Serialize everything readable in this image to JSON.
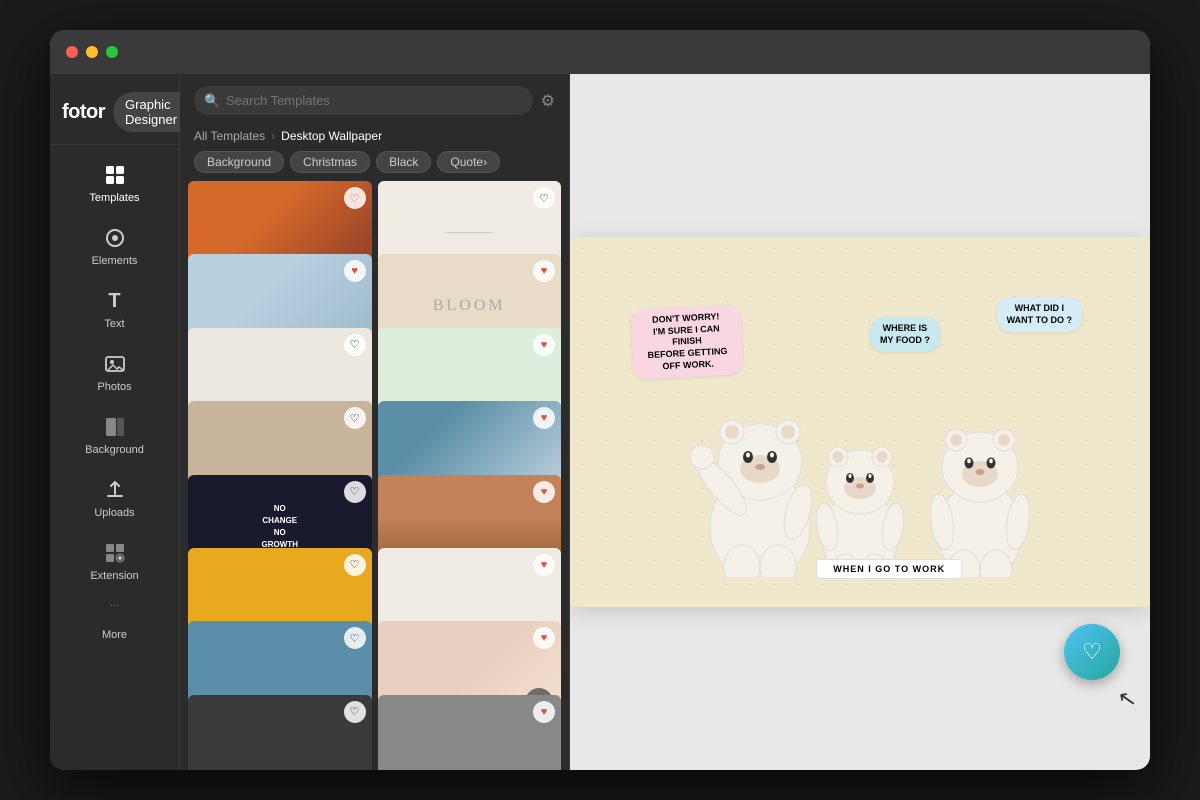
{
  "window": {
    "title": "Fotor Graphic Designer"
  },
  "header": {
    "logo": "fotor",
    "logo_sup": "®",
    "designer_label": "Graphic Designer",
    "chevron": "▾"
  },
  "sidebar": {
    "items": [
      {
        "id": "templates",
        "label": "Templates",
        "icon": "⊞",
        "active": true
      },
      {
        "id": "elements",
        "label": "Elements",
        "icon": "◎"
      },
      {
        "id": "text",
        "label": "Text",
        "icon": "T"
      },
      {
        "id": "photos",
        "label": "Photos",
        "icon": "🖼"
      },
      {
        "id": "background",
        "label": "Background",
        "icon": "◧"
      },
      {
        "id": "uploads",
        "label": "Uploads",
        "icon": "⬆"
      },
      {
        "id": "extension",
        "label": "Extension",
        "icon": "▦"
      },
      {
        "id": "more",
        "label": "More",
        "icon": "···"
      }
    ]
  },
  "templates_panel": {
    "search_placeholder": "Search Templates",
    "filter_icon": "▼",
    "breadcrumb": {
      "root": "All Templates",
      "sep": "›",
      "current": "Desktop Wallpaper"
    },
    "filter_tags": [
      "Background",
      "Christmas",
      "Black",
      "Quote"
    ],
    "scroll_up_icon": "▲"
  },
  "canvas": {
    "speech_bubbles": [
      {
        "text": "DON'T WORRY!\nI'M SURE I CAN FINISH\nBEFORE GETTING OFF WORK.",
        "style": "pink",
        "class": "bear-left-bubble"
      },
      {
        "text": "WHERE IS\nMY FOOD ?",
        "style": "blue",
        "class": "bear-mid-bubble"
      },
      {
        "text": "WHAT DID I\nWANT TO DO ?",
        "style": "light-blue",
        "class": "bear-right-bubble"
      }
    ],
    "banner_text": "WHEN I GO TO WORK"
  },
  "fab": {
    "icon": "♡",
    "tooltip": "Favorites"
  },
  "colors": {
    "accent": "#4fc3f7",
    "accent2": "#26a69a",
    "sidebar_bg": "#2b2b2b",
    "header_bg": "#3a3a3a"
  }
}
